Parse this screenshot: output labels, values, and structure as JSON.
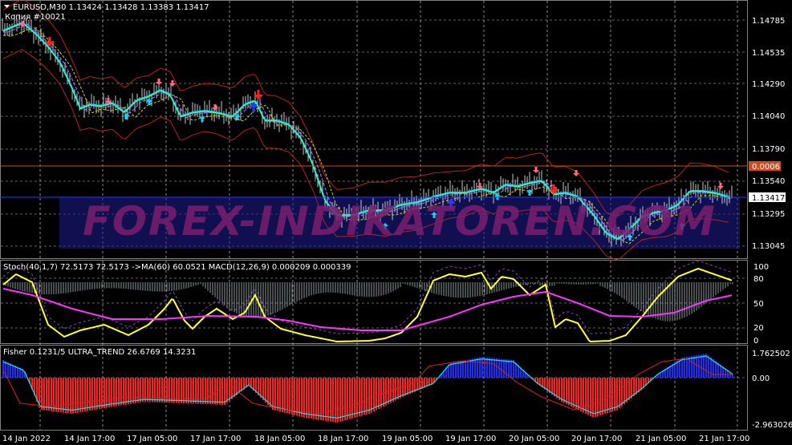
{
  "colors": {
    "background": "#000000",
    "grid": "#c0c0c0",
    "bb_bands": "#b22222",
    "fast_ma": "#00e0ff",
    "trend_ma": "#9966ff",
    "slow_ma": "#d8d800",
    "arrow_up": "#00d8ff",
    "arrow_down": "#ff6688",
    "stoch": "#ffff33",
    "stoch_ma": "#ff33ff",
    "macd_hist": "#b0c4c4",
    "fisher_pos": "#1f2bff",
    "fisher_neg": "#ff1f1f",
    "ultra_cyan": "#22d7e5",
    "ultra_red": "#e02020",
    "price_level_orange": "#d24a1a",
    "price_level_blue": "#2a3bff",
    "watermark_band": "#1e1b8f"
  },
  "header": {
    "symbol_line": "EURUSD,M30  1.13424 1.13428 1.13383 1.13417",
    "copy_line": "Копия #10021"
  },
  "watermark": "FOREX-INDIKATOREN.COM",
  "price_axis": {
    "ticks": [
      "1.14785",
      "1.14535",
      "1.14290",
      "1.14040",
      "1.13790",
      "1.13540",
      "1.13295",
      "1.13045"
    ],
    "badge_orange": "0.0006",
    "badge_current": "1.13417"
  },
  "indicator1": {
    "header": "Stoch(40,1,7) 72.5173 72.5173  ->MA(60) 60.0521  MACD(12,26,9) 0.000209 0.000339",
    "axis_ticks": [
      "100",
      "80",
      "50",
      "20",
      "0"
    ]
  },
  "indicator2": {
    "header": "Fisher 0.1231/5  ULTRA_TREND 26.6769 14.3231",
    "axis_ticks": [
      "1.762502",
      "0.00",
      "-2.963026"
    ]
  },
  "time_axis": {
    "labels": [
      "14 Jan 2022",
      "14 Jan 17:00",
      "17 Jan 05:00",
      "17 Jan 17:00",
      "18 Jan 05:00",
      "18 Jan 17:00",
      "19 Jan 05:00",
      "19 Jan 17:00",
      "20 Jan 05:00",
      "20 Jan 17:00",
      "21 Jan 05:00",
      "21 Jan 17:00"
    ]
  }
}
